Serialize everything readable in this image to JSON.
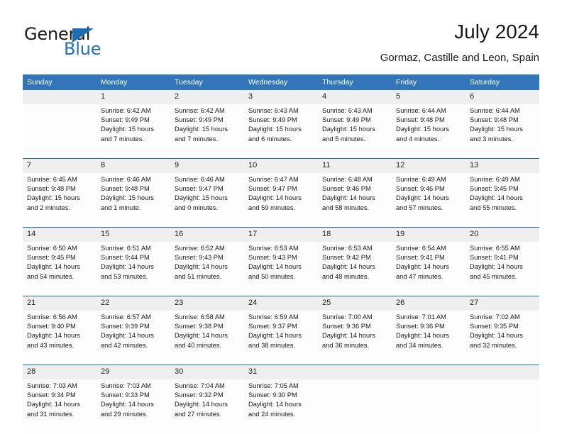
{
  "brand": {
    "name_part1": "General",
    "name_part2": "Blue",
    "logo_icon": "blue-triangle-logo"
  },
  "header": {
    "title": "July 2024",
    "subtitle": "Gormaz, Castille and Leon, Spain"
  },
  "colors": {
    "header_blue": "#3275b8",
    "separator_blue": "#1b6cb0",
    "daynum_band": "#efefef",
    "brand_blue": "#2272b8",
    "text": "#1a1a1a"
  },
  "weekday_headers": [
    "Sunday",
    "Monday",
    "Tuesday",
    "Wednesday",
    "Thursday",
    "Friday",
    "Saturday"
  ],
  "weeks": [
    {
      "days": [
        {
          "num": "",
          "sunrise": "",
          "sunset": "",
          "daylight_l1": "",
          "daylight_l2": ""
        },
        {
          "num": "1",
          "sunrise": "Sunrise: 6:42 AM",
          "sunset": "Sunset: 9:49 PM",
          "daylight_l1": "Daylight: 15 hours",
          "daylight_l2": "and 7 minutes."
        },
        {
          "num": "2",
          "sunrise": "Sunrise: 6:42 AM",
          "sunset": "Sunset: 9:49 PM",
          "daylight_l1": "Daylight: 15 hours",
          "daylight_l2": "and 7 minutes."
        },
        {
          "num": "3",
          "sunrise": "Sunrise: 6:43 AM",
          "sunset": "Sunset: 9:49 PM",
          "daylight_l1": "Daylight: 15 hours",
          "daylight_l2": "and 6 minutes."
        },
        {
          "num": "4",
          "sunrise": "Sunrise: 6:43 AM",
          "sunset": "Sunset: 9:49 PM",
          "daylight_l1": "Daylight: 15 hours",
          "daylight_l2": "and 5 minutes."
        },
        {
          "num": "5",
          "sunrise": "Sunrise: 6:44 AM",
          "sunset": "Sunset: 9:48 PM",
          "daylight_l1": "Daylight: 15 hours",
          "daylight_l2": "and 4 minutes."
        },
        {
          "num": "6",
          "sunrise": "Sunrise: 6:44 AM",
          "sunset": "Sunset: 9:48 PM",
          "daylight_l1": "Daylight: 15 hours",
          "daylight_l2": "and 3 minutes."
        }
      ]
    },
    {
      "days": [
        {
          "num": "7",
          "sunrise": "Sunrise: 6:45 AM",
          "sunset": "Sunset: 9:48 PM",
          "daylight_l1": "Daylight: 15 hours",
          "daylight_l2": "and 2 minutes."
        },
        {
          "num": "8",
          "sunrise": "Sunrise: 6:46 AM",
          "sunset": "Sunset: 9:48 PM",
          "daylight_l1": "Daylight: 15 hours",
          "daylight_l2": "and 1 minute."
        },
        {
          "num": "9",
          "sunrise": "Sunrise: 6:46 AM",
          "sunset": "Sunset: 9:47 PM",
          "daylight_l1": "Daylight: 15 hours",
          "daylight_l2": "and 0 minutes."
        },
        {
          "num": "10",
          "sunrise": "Sunrise: 6:47 AM",
          "sunset": "Sunset: 9:47 PM",
          "daylight_l1": "Daylight: 14 hours",
          "daylight_l2": "and 59 minutes."
        },
        {
          "num": "11",
          "sunrise": "Sunrise: 6:48 AM",
          "sunset": "Sunset: 9:46 PM",
          "daylight_l1": "Daylight: 14 hours",
          "daylight_l2": "and 58 minutes."
        },
        {
          "num": "12",
          "sunrise": "Sunrise: 6:49 AM",
          "sunset": "Sunset: 9:46 PM",
          "daylight_l1": "Daylight: 14 hours",
          "daylight_l2": "and 57 minutes."
        },
        {
          "num": "13",
          "sunrise": "Sunrise: 6:49 AM",
          "sunset": "Sunset: 9:45 PM",
          "daylight_l1": "Daylight: 14 hours",
          "daylight_l2": "and 55 minutes."
        }
      ]
    },
    {
      "days": [
        {
          "num": "14",
          "sunrise": "Sunrise: 6:50 AM",
          "sunset": "Sunset: 9:45 PM",
          "daylight_l1": "Daylight: 14 hours",
          "daylight_l2": "and 54 minutes."
        },
        {
          "num": "15",
          "sunrise": "Sunrise: 6:51 AM",
          "sunset": "Sunset: 9:44 PM",
          "daylight_l1": "Daylight: 14 hours",
          "daylight_l2": "and 53 minutes."
        },
        {
          "num": "16",
          "sunrise": "Sunrise: 6:52 AM",
          "sunset": "Sunset: 9:43 PM",
          "daylight_l1": "Daylight: 14 hours",
          "daylight_l2": "and 51 minutes."
        },
        {
          "num": "17",
          "sunrise": "Sunrise: 6:53 AM",
          "sunset": "Sunset: 9:43 PM",
          "daylight_l1": "Daylight: 14 hours",
          "daylight_l2": "and 50 minutes."
        },
        {
          "num": "18",
          "sunrise": "Sunrise: 6:53 AM",
          "sunset": "Sunset: 9:42 PM",
          "daylight_l1": "Daylight: 14 hours",
          "daylight_l2": "and 48 minutes."
        },
        {
          "num": "19",
          "sunrise": "Sunrise: 6:54 AM",
          "sunset": "Sunset: 9:41 PM",
          "daylight_l1": "Daylight: 14 hours",
          "daylight_l2": "and 47 minutes."
        },
        {
          "num": "20",
          "sunrise": "Sunrise: 6:55 AM",
          "sunset": "Sunset: 9:41 PM",
          "daylight_l1": "Daylight: 14 hours",
          "daylight_l2": "and 45 minutes."
        }
      ]
    },
    {
      "days": [
        {
          "num": "21",
          "sunrise": "Sunrise: 6:56 AM",
          "sunset": "Sunset: 9:40 PM",
          "daylight_l1": "Daylight: 14 hours",
          "daylight_l2": "and 43 minutes."
        },
        {
          "num": "22",
          "sunrise": "Sunrise: 6:57 AM",
          "sunset": "Sunset: 9:39 PM",
          "daylight_l1": "Daylight: 14 hours",
          "daylight_l2": "and 42 minutes."
        },
        {
          "num": "23",
          "sunrise": "Sunrise: 6:58 AM",
          "sunset": "Sunset: 9:38 PM",
          "daylight_l1": "Daylight: 14 hours",
          "daylight_l2": "and 40 minutes."
        },
        {
          "num": "24",
          "sunrise": "Sunrise: 6:59 AM",
          "sunset": "Sunset: 9:37 PM",
          "daylight_l1": "Daylight: 14 hours",
          "daylight_l2": "and 38 minutes."
        },
        {
          "num": "25",
          "sunrise": "Sunrise: 7:00 AM",
          "sunset": "Sunset: 9:36 PM",
          "daylight_l1": "Daylight: 14 hours",
          "daylight_l2": "and 36 minutes."
        },
        {
          "num": "26",
          "sunrise": "Sunrise: 7:01 AM",
          "sunset": "Sunset: 9:36 PM",
          "daylight_l1": "Daylight: 14 hours",
          "daylight_l2": "and 34 minutes."
        },
        {
          "num": "27",
          "sunrise": "Sunrise: 7:02 AM",
          "sunset": "Sunset: 9:35 PM",
          "daylight_l1": "Daylight: 14 hours",
          "daylight_l2": "and 32 minutes."
        }
      ]
    },
    {
      "days": [
        {
          "num": "28",
          "sunrise": "Sunrise: 7:03 AM",
          "sunset": "Sunset: 9:34 PM",
          "daylight_l1": "Daylight: 14 hours",
          "daylight_l2": "and 31 minutes."
        },
        {
          "num": "29",
          "sunrise": "Sunrise: 7:03 AM",
          "sunset": "Sunset: 9:33 PM",
          "daylight_l1": "Daylight: 14 hours",
          "daylight_l2": "and 29 minutes."
        },
        {
          "num": "30",
          "sunrise": "Sunrise: 7:04 AM",
          "sunset": "Sunset: 9:32 PM",
          "daylight_l1": "Daylight: 14 hours",
          "daylight_l2": "and 27 minutes."
        },
        {
          "num": "31",
          "sunrise": "Sunrise: 7:05 AM",
          "sunset": "Sunset: 9:30 PM",
          "daylight_l1": "Daylight: 14 hours",
          "daylight_l2": "and 24 minutes."
        },
        {
          "num": "",
          "sunrise": "",
          "sunset": "",
          "daylight_l1": "",
          "daylight_l2": ""
        },
        {
          "num": "",
          "sunrise": "",
          "sunset": "",
          "daylight_l1": "",
          "daylight_l2": ""
        },
        {
          "num": "",
          "sunrise": "",
          "sunset": "",
          "daylight_l1": "",
          "daylight_l2": ""
        }
      ]
    }
  ]
}
